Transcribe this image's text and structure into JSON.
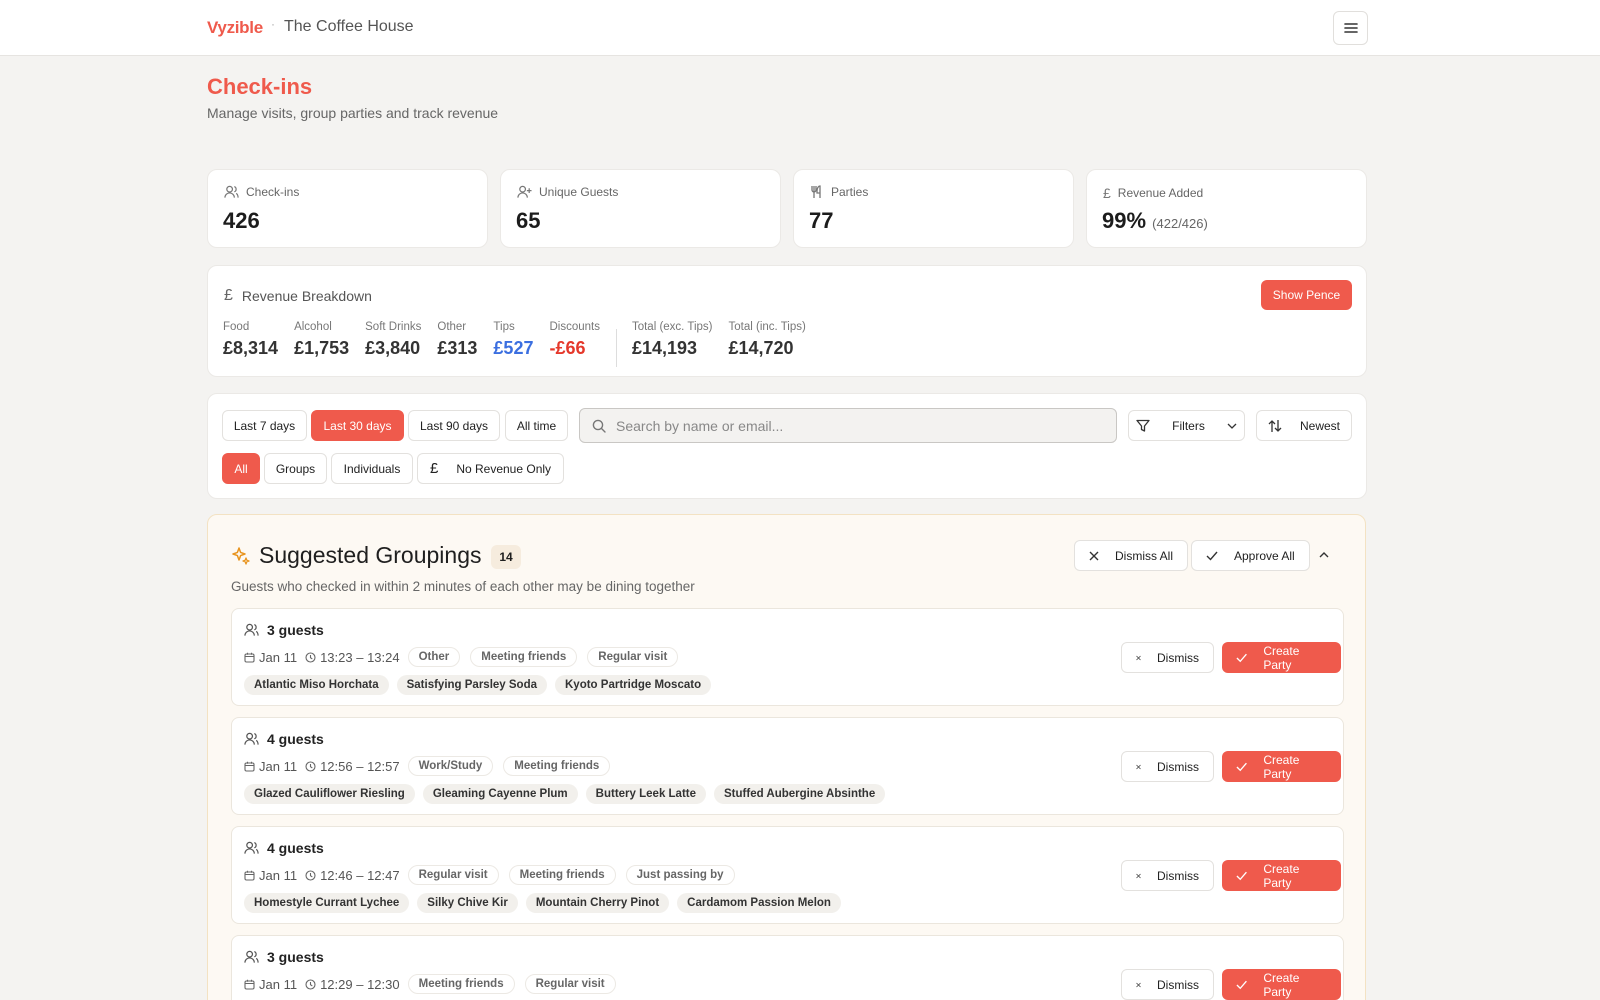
{
  "header": {
    "brand": "Vyzible",
    "separator": "·",
    "venue": "The Coffee House"
  },
  "page": {
    "title": "Check-ins",
    "subtitle": "Manage visits, group parties and track revenue"
  },
  "stats": [
    {
      "icon": "users-icon",
      "label": "Check-ins",
      "value": "426",
      "extra": ""
    },
    {
      "icon": "user-plus-icon",
      "label": "Unique Guests",
      "value": "65",
      "extra": ""
    },
    {
      "icon": "utensils-icon",
      "label": "Parties",
      "value": "77",
      "extra": ""
    },
    {
      "icon": "pound-icon",
      "label": "Revenue Added",
      "value": "99%",
      "extra": "(422/426)"
    }
  ],
  "revenue": {
    "title": "Revenue Breakdown",
    "toggle_label": "Show Pence",
    "items": [
      {
        "label": "Food",
        "value": "£8,314",
        "color": "#333333"
      },
      {
        "label": "Alcohol",
        "value": "£1,753",
        "color": "#333333"
      },
      {
        "label": "Soft Drinks",
        "value": "£3,840",
        "color": "#333333"
      },
      {
        "label": "Other",
        "value": "£313",
        "color": "#333333"
      },
      {
        "label": "Tips",
        "value": "£527",
        "color": "#3b6fe0"
      },
      {
        "label": "Discounts",
        "value": "-£66",
        "color": "#e5382b"
      }
    ],
    "totals": [
      {
        "label": "Total (exc. Tips)",
        "value": "£14,193"
      },
      {
        "label": "Total (inc. Tips)",
        "value": "£14,720"
      }
    ]
  },
  "filters": {
    "ranges": [
      "Last 7 days",
      "Last 30 days",
      "Last 90 days",
      "All time"
    ],
    "active_range": "Last 30 days",
    "search_placeholder": "Search by name or email...",
    "filters_label": "Filters",
    "sort_label": "Newest",
    "types": [
      "All",
      "Groups",
      "Individuals",
      "No Revenue Only"
    ],
    "active_type": "All"
  },
  "suggestions": {
    "title": "Suggested Groupings",
    "count": "14",
    "subtitle": "Guests who checked in within 2 minutes of each other may be dining together",
    "dismiss_all": "Dismiss All",
    "approve_all": "Approve All",
    "dismiss_label": "Dismiss",
    "create_label": "Create Party",
    "groups": [
      {
        "guests": "3 guests",
        "date": "Jan 11",
        "time": "13:23 – 13:24",
        "tags": [
          "Other",
          "Meeting friends",
          "Regular visit"
        ],
        "names": [
          "Atlantic Miso Horchata",
          "Satisfying Parsley Soda",
          "Kyoto Partridge Moscato"
        ]
      },
      {
        "guests": "4 guests",
        "date": "Jan 11",
        "time": "12:56 – 12:57",
        "tags": [
          "Work/Study",
          "Meeting friends"
        ],
        "names": [
          "Glazed Cauliflower Riesling",
          "Gleaming Cayenne Plum",
          "Buttery Leek Latte",
          "Stuffed Aubergine Absinthe"
        ]
      },
      {
        "guests": "4 guests",
        "date": "Jan 11",
        "time": "12:46 – 12:47",
        "tags": [
          "Regular visit",
          "Meeting friends",
          "Just passing by"
        ],
        "names": [
          "Homestyle Currant Lychee",
          "Silky Chive Kir",
          "Mountain Cherry Pinot",
          "Cardamom Passion Melon"
        ]
      },
      {
        "guests": "3 guests",
        "date": "Jan 11",
        "time": "12:29 – 12:30",
        "tags": [
          "Meeting friends",
          "Regular visit"
        ],
        "names": []
      }
    ]
  }
}
